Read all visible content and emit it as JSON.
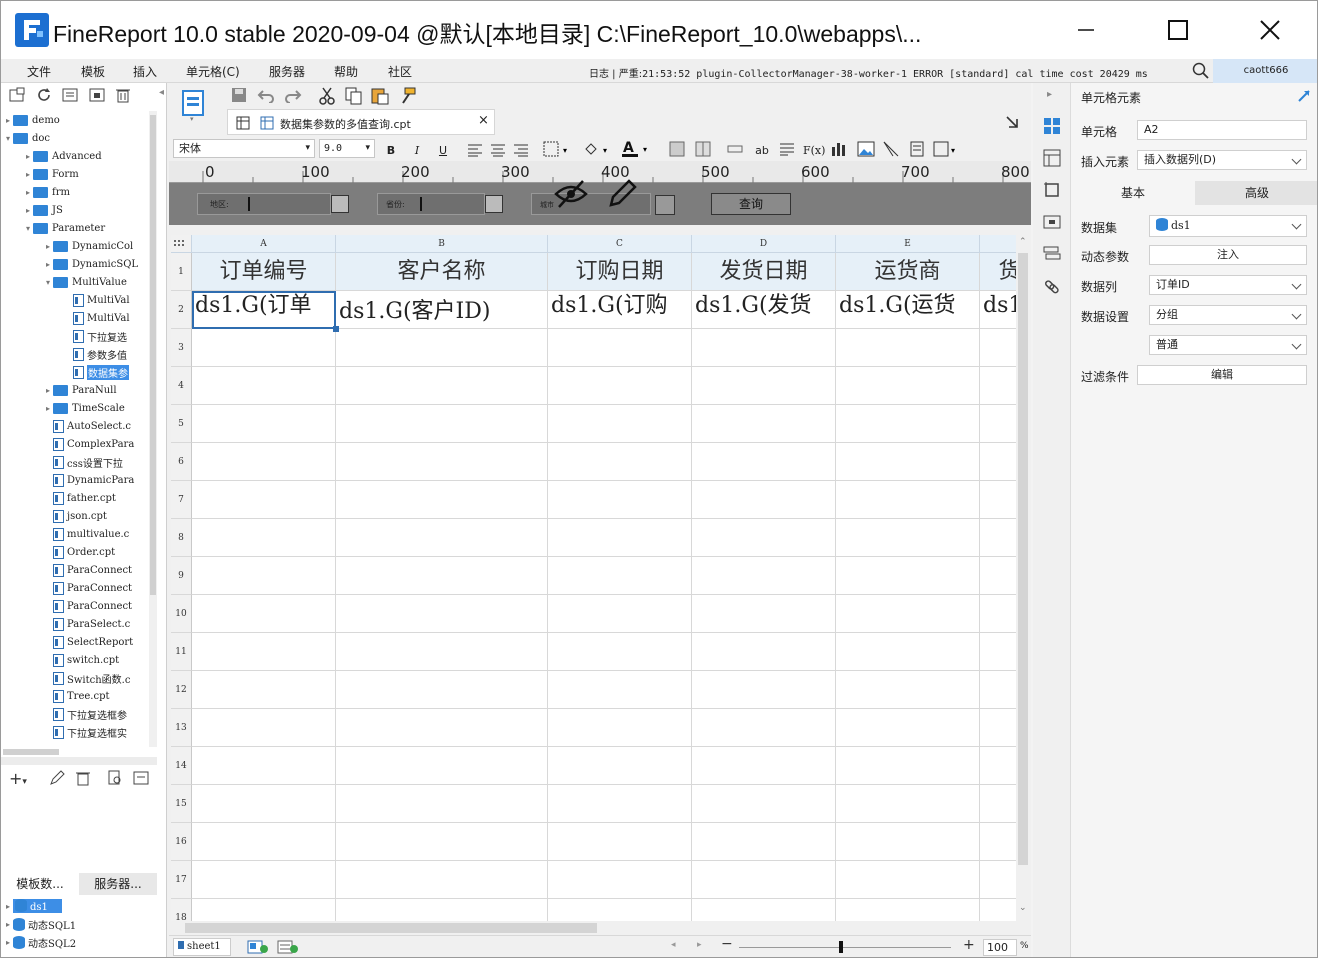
{
  "window": {
    "title": "FineReport 10.0 stable 2020-09-04 @默认[本地目录]    C:\\FineReport_10.0\\webapps\\..."
  },
  "menu": [
    "文件",
    "模板",
    "插入",
    "单元格(C)",
    "服务器",
    "帮助",
    "社区"
  ],
  "log": {
    "label": "日志 | 严重:",
    "text": "21:53:52 plugin-CollectorManager-38-worker-1 ERROR [standard] cal time cost 20429 ms"
  },
  "user": "caott666",
  "tree": [
    {
      "label": "demo",
      "type": "folder",
      "level": 0,
      "arrow": "▸"
    },
    {
      "label": "doc",
      "type": "folder",
      "level": 0,
      "arrow": "▾"
    },
    {
      "label": "Advanced",
      "type": "folder",
      "level": 1,
      "arrow": "▸"
    },
    {
      "label": "Form",
      "type": "folder",
      "level": 1,
      "arrow": "▸"
    },
    {
      "label": "frm",
      "type": "folder",
      "level": 1,
      "arrow": "▸"
    },
    {
      "label": "JS",
      "type": "folder",
      "level": 1,
      "arrow": "▸"
    },
    {
      "label": "Parameter",
      "type": "folder",
      "level": 1,
      "arrow": "▾"
    },
    {
      "label": "DynamicCol",
      "type": "folder",
      "level": 2,
      "arrow": "▸"
    },
    {
      "label": "DynamicSQL",
      "type": "folder",
      "level": 2,
      "arrow": "▸"
    },
    {
      "label": "MultiValue",
      "type": "folder",
      "level": 2,
      "arrow": "▾"
    },
    {
      "label": "MultiVal",
      "type": "file",
      "level": 3,
      "arrow": ""
    },
    {
      "label": "MultiVal",
      "type": "file",
      "level": 3,
      "arrow": ""
    },
    {
      "label": "下拉复选",
      "type": "file",
      "level": 3,
      "arrow": ""
    },
    {
      "label": "参数多值",
      "type": "file",
      "level": 3,
      "arrow": ""
    },
    {
      "label": "数据集参",
      "type": "file",
      "level": 3,
      "arrow": "",
      "selected": true
    },
    {
      "label": "ParaNull",
      "type": "folder",
      "level": 2,
      "arrow": "▸"
    },
    {
      "label": "TimeScale",
      "type": "folder",
      "level": 2,
      "arrow": "▸"
    },
    {
      "label": "AutoSelect.c",
      "type": "file",
      "level": 2,
      "arrow": ""
    },
    {
      "label": "ComplexPara",
      "type": "file",
      "level": 2,
      "arrow": ""
    },
    {
      "label": "css设置下拉",
      "type": "file",
      "level": 2,
      "arrow": ""
    },
    {
      "label": "DynamicPara",
      "type": "file",
      "level": 2,
      "arrow": ""
    },
    {
      "label": "father.cpt",
      "type": "file",
      "level": 2,
      "arrow": ""
    },
    {
      "label": "json.cpt",
      "type": "file",
      "level": 2,
      "arrow": ""
    },
    {
      "label": "multivalue.c",
      "type": "file",
      "level": 2,
      "arrow": ""
    },
    {
      "label": "Order.cpt",
      "type": "file",
      "level": 2,
      "arrow": ""
    },
    {
      "label": "ParaConnect",
      "type": "file",
      "level": 2,
      "arrow": ""
    },
    {
      "label": "ParaConnect",
      "type": "file",
      "level": 2,
      "arrow": ""
    },
    {
      "label": "ParaConnect",
      "type": "file",
      "level": 2,
      "arrow": ""
    },
    {
      "label": "ParaSelect.c",
      "type": "file",
      "level": 2,
      "arrow": ""
    },
    {
      "label": "SelectReport",
      "type": "file",
      "level": 2,
      "arrow": ""
    },
    {
      "label": "switch.cpt",
      "type": "file",
      "level": 2,
      "arrow": ""
    },
    {
      "label": "Switch函数.c",
      "type": "file",
      "level": 2,
      "arrow": ""
    },
    {
      "label": "Tree.cpt",
      "type": "file",
      "level": 2,
      "arrow": ""
    },
    {
      "label": "下拉复选框参",
      "type": "file",
      "level": 2,
      "arrow": ""
    },
    {
      "label": "下拉复选框实",
      "type": "file",
      "level": 2,
      "arrow": ""
    }
  ],
  "dsTabs": [
    "模板数...",
    "服务器..."
  ],
  "datasets": [
    {
      "label": "ds1",
      "selected": true
    },
    {
      "label": "动态SQL1",
      "selected": false
    },
    {
      "label": "动态SQL2",
      "selected": false
    }
  ],
  "editorTab": {
    "label": "数据集参数的多值查询.cpt"
  },
  "fontbar": {
    "font": "宋体",
    "size": "9.0"
  },
  "ruler": [
    "0",
    "100",
    "200",
    "300",
    "400",
    "500",
    "600",
    "700",
    "800"
  ],
  "params": {
    "label1": "地区:",
    "label2": "省份:",
    "label3": "城市",
    "query": "查询"
  },
  "columns": [
    "A",
    "B",
    "C",
    "D",
    "E",
    ""
  ],
  "rows": [
    "1",
    "2",
    "3",
    "4",
    "5",
    "6",
    "7",
    "8",
    "9",
    "10",
    "11",
    "12",
    "13",
    "14",
    "15",
    "16",
    "17",
    "18"
  ],
  "headerRow": [
    "订单编号",
    "客户名称",
    "订购日期",
    "发货日期",
    "运货商",
    "货"
  ],
  "dataRow": [
    "ds1.G(订单",
    "ds1.G(客户ID)",
    "ds1.G(订购",
    "ds1.G(发货",
    "ds1.G(运货",
    "ds1"
  ],
  "sheetTab": "sheet1",
  "zoom": "100",
  "zoomUnit": "%",
  "rightPanel": {
    "title": "单元格元素",
    "cellLabel": "单元格",
    "cellValue": "A2",
    "insertLabel": "插入元素",
    "insertValue": "插入数据列(D)",
    "tabBasic": "基本",
    "tabAdvanced": "高级",
    "datasetLabel": "数据集",
    "datasetValue": "ds1",
    "dynParamLabel": "动态参数",
    "dynParamButton": "注入",
    "dataColLabel": "数据列",
    "dataColValue": "订单ID",
    "dataSetLabel": "数据设置",
    "dataSetValue": "分组",
    "normalValue": "普通",
    "filterLabel": "过滤条件",
    "filterButton": "编辑"
  },
  "colors": {
    "accent": "#2f84d6",
    "selection": "#3d8ee6",
    "header": "#e6f0f8",
    "paramBg": "#7d7d7d"
  }
}
